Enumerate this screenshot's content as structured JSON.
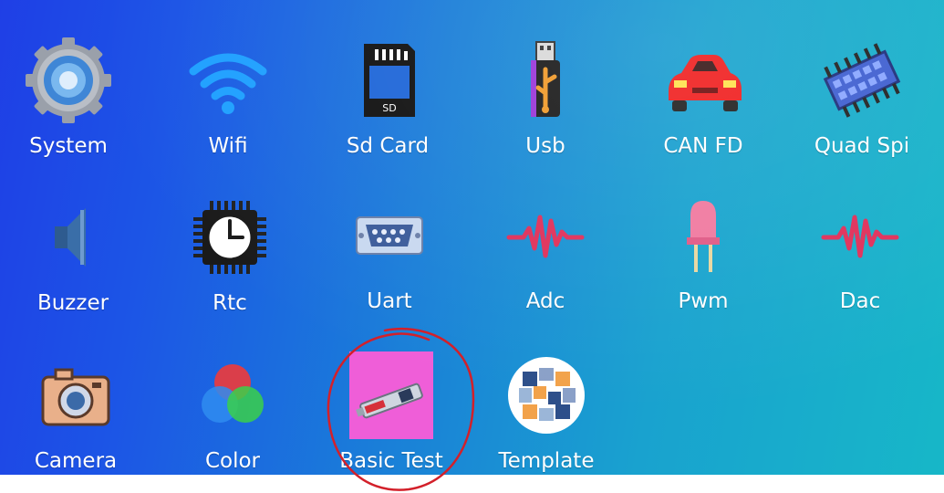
{
  "apps": [
    {
      "label": "System",
      "icon": "gear-icon"
    },
    {
      "label": "Wifi",
      "icon": "wifi-icon"
    },
    {
      "label": "Sd Card",
      "icon": "sd-card-icon"
    },
    {
      "label": "Usb",
      "icon": "usb-icon"
    },
    {
      "label": "CAN FD",
      "icon": "car-icon"
    },
    {
      "label": "Quad Spi",
      "icon": "chip-icon"
    },
    {
      "label": "Buzzer",
      "icon": "speaker-icon"
    },
    {
      "label": "Rtc",
      "icon": "clock-chip-icon"
    },
    {
      "label": "Uart",
      "icon": "serial-port-icon"
    },
    {
      "label": "Adc",
      "icon": "waveform-icon"
    },
    {
      "label": "Pwm",
      "icon": "led-icon"
    },
    {
      "label": "Dac",
      "icon": "waveform-icon"
    },
    {
      "label": "Camera",
      "icon": "camera-icon"
    },
    {
      "label": "Color",
      "icon": "color-circles-icon"
    },
    {
      "label": "Basic Test",
      "icon": "test-tool-icon"
    },
    {
      "label": "Template",
      "icon": "template-tiles-icon"
    }
  ],
  "colors": {
    "screen_left": "#1f3fe6",
    "screen_right": "#17b7c8",
    "label_text": "#ffffff",
    "annotation": "#d3202a"
  }
}
